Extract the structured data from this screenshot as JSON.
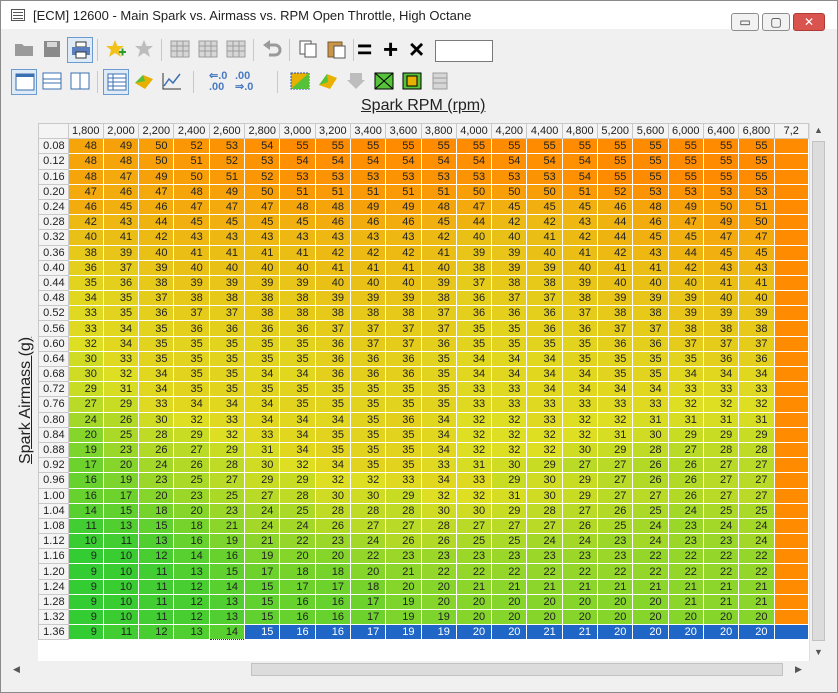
{
  "window": {
    "title": "[ECM] 12600 - Main Spark vs. Airmass vs. RPM Open Throttle, High Octane",
    "minimize": "▭",
    "maximize": "▢",
    "close": "✕"
  },
  "toolbar": {
    "operators": [
      "=",
      "+",
      "×"
    ],
    "value": "",
    "adjust_up": ".0 .00",
    "adjust_down": ".00 .0"
  },
  "table": {
    "x_axis_title": "Spark RPM (rpm)",
    "y_axis_title": "Spark Airmass (g)",
    "columns": [
      "1,800",
      "2,000",
      "2,200",
      "2,400",
      "2,600",
      "2,800",
      "3,000",
      "3,200",
      "3,400",
      "3,600",
      "3,800",
      "4,000",
      "4,200",
      "4,400",
      "4,800",
      "5,200",
      "5,600",
      "6,000",
      "6,400",
      "6,800",
      "7,2"
    ],
    "rows": [
      "0.08",
      "0.12",
      "0.16",
      "0.20",
      "0.24",
      "0.28",
      "0.32",
      "0.36",
      "0.40",
      "0.44",
      "0.48",
      "0.52",
      "0.56",
      "0.60",
      "0.64",
      "0.68",
      "0.72",
      "0.76",
      "0.80",
      "0.84",
      "0.88",
      "0.92",
      "0.96",
      "1.00",
      "1.04",
      "1.08",
      "1.12",
      "1.16",
      "1.20",
      "1.24",
      "1.28",
      "1.32",
      "1.36"
    ],
    "values": [
      [
        "48",
        "49",
        "50",
        "52",
        "53",
        "54",
        "55",
        "55",
        "55",
        "55",
        "55",
        "55",
        "55",
        "55",
        "55",
        "55",
        "55",
        "55",
        "55",
        "55",
        ""
      ],
      [
        "48",
        "48",
        "50",
        "51",
        "52",
        "53",
        "54",
        "54",
        "54",
        "54",
        "54",
        "54",
        "54",
        "54",
        "54",
        "55",
        "55",
        "55",
        "55",
        "55",
        ""
      ],
      [
        "48",
        "47",
        "49",
        "50",
        "51",
        "52",
        "53",
        "53",
        "53",
        "53",
        "53",
        "53",
        "53",
        "53",
        "54",
        "55",
        "55",
        "55",
        "55",
        "55",
        ""
      ],
      [
        "47",
        "46",
        "47",
        "48",
        "49",
        "50",
        "51",
        "51",
        "51",
        "51",
        "51",
        "50",
        "50",
        "50",
        "51",
        "52",
        "53",
        "53",
        "53",
        "53",
        ""
      ],
      [
        "46",
        "45",
        "46",
        "47",
        "47",
        "47",
        "48",
        "48",
        "49",
        "49",
        "48",
        "47",
        "45",
        "45",
        "45",
        "46",
        "48",
        "49",
        "50",
        "51",
        ""
      ],
      [
        "42",
        "43",
        "44",
        "45",
        "45",
        "45",
        "45",
        "46",
        "46",
        "46",
        "45",
        "44",
        "42",
        "42",
        "43",
        "44",
        "46",
        "47",
        "49",
        "50",
        ""
      ],
      [
        "40",
        "41",
        "42",
        "43",
        "43",
        "43",
        "43",
        "43",
        "43",
        "43",
        "42",
        "40",
        "40",
        "41",
        "42",
        "44",
        "45",
        "45",
        "47",
        "47",
        ""
      ],
      [
        "38",
        "39",
        "40",
        "41",
        "41",
        "41",
        "41",
        "42",
        "42",
        "42",
        "41",
        "39",
        "39",
        "40",
        "41",
        "42",
        "43",
        "44",
        "45",
        "45",
        ""
      ],
      [
        "36",
        "37",
        "39",
        "40",
        "40",
        "40",
        "40",
        "41",
        "41",
        "41",
        "40",
        "38",
        "39",
        "39",
        "40",
        "41",
        "41",
        "42",
        "43",
        "43",
        ""
      ],
      [
        "35",
        "36",
        "38",
        "39",
        "39",
        "39",
        "39",
        "40",
        "40",
        "40",
        "39",
        "37",
        "38",
        "38",
        "39",
        "40",
        "40",
        "40",
        "41",
        "41",
        ""
      ],
      [
        "34",
        "35",
        "37",
        "38",
        "38",
        "38",
        "38",
        "39",
        "39",
        "39",
        "38",
        "36",
        "37",
        "37",
        "38",
        "39",
        "39",
        "39",
        "40",
        "40",
        ""
      ],
      [
        "33",
        "35",
        "36",
        "37",
        "37",
        "38",
        "38",
        "38",
        "38",
        "38",
        "37",
        "36",
        "36",
        "36",
        "37",
        "38",
        "38",
        "39",
        "39",
        "39",
        ""
      ],
      [
        "33",
        "34",
        "35",
        "36",
        "36",
        "36",
        "36",
        "37",
        "37",
        "37",
        "37",
        "35",
        "35",
        "36",
        "36",
        "37",
        "37",
        "38",
        "38",
        "38",
        ""
      ],
      [
        "32",
        "34",
        "35",
        "35",
        "35",
        "35",
        "35",
        "36",
        "37",
        "37",
        "36",
        "35",
        "35",
        "35",
        "35",
        "36",
        "36",
        "37",
        "37",
        "37",
        ""
      ],
      [
        "30",
        "33",
        "35",
        "35",
        "35",
        "35",
        "35",
        "36",
        "36",
        "36",
        "35",
        "34",
        "34",
        "34",
        "35",
        "35",
        "35",
        "35",
        "36",
        "36",
        ""
      ],
      [
        "30",
        "32",
        "34",
        "35",
        "35",
        "34",
        "34",
        "36",
        "36",
        "36",
        "35",
        "34",
        "34",
        "34",
        "34",
        "35",
        "35",
        "34",
        "34",
        "34",
        ""
      ],
      [
        "29",
        "31",
        "34",
        "35",
        "35",
        "35",
        "35",
        "35",
        "35",
        "35",
        "35",
        "33",
        "33",
        "34",
        "34",
        "34",
        "34",
        "33",
        "33",
        "33",
        ""
      ],
      [
        "27",
        "29",
        "33",
        "34",
        "34",
        "34",
        "35",
        "35",
        "35",
        "35",
        "35",
        "33",
        "33",
        "33",
        "33",
        "33",
        "33",
        "32",
        "32",
        "32",
        ""
      ],
      [
        "24",
        "26",
        "30",
        "32",
        "33",
        "34",
        "34",
        "34",
        "35",
        "36",
        "34",
        "32",
        "32",
        "33",
        "32",
        "32",
        "31",
        "31",
        "31",
        "31",
        ""
      ],
      [
        "20",
        "25",
        "28",
        "29",
        "32",
        "33",
        "34",
        "35",
        "35",
        "35",
        "34",
        "32",
        "32",
        "32",
        "32",
        "31",
        "30",
        "29",
        "29",
        "29",
        ""
      ],
      [
        "19",
        "23",
        "26",
        "27",
        "29",
        "31",
        "34",
        "35",
        "35",
        "35",
        "34",
        "32",
        "32",
        "32",
        "30",
        "29",
        "28",
        "27",
        "28",
        "28",
        ""
      ],
      [
        "17",
        "20",
        "24",
        "26",
        "28",
        "30",
        "32",
        "34",
        "35",
        "35",
        "33",
        "31",
        "30",
        "29",
        "27",
        "27",
        "26",
        "26",
        "27",
        "27",
        ""
      ],
      [
        "16",
        "19",
        "23",
        "25",
        "27",
        "29",
        "29",
        "32",
        "32",
        "33",
        "34",
        "33",
        "29",
        "30",
        "29",
        "27",
        "26",
        "26",
        "27",
        "27",
        ""
      ],
      [
        "16",
        "17",
        "20",
        "23",
        "25",
        "27",
        "28",
        "30",
        "30",
        "29",
        "32",
        "32",
        "31",
        "30",
        "29",
        "27",
        "27",
        "26",
        "27",
        "27",
        ""
      ],
      [
        "14",
        "15",
        "18",
        "20",
        "23",
        "24",
        "25",
        "28",
        "28",
        "28",
        "30",
        "30",
        "29",
        "28",
        "27",
        "26",
        "25",
        "24",
        "25",
        "25",
        ""
      ],
      [
        "11",
        "13",
        "15",
        "18",
        "21",
        "24",
        "24",
        "26",
        "27",
        "27",
        "28",
        "27",
        "27",
        "27",
        "26",
        "25",
        "24",
        "23",
        "24",
        "24",
        ""
      ],
      [
        "10",
        "11",
        "13",
        "16",
        "19",
        "21",
        "22",
        "23",
        "24",
        "26",
        "26",
        "25",
        "25",
        "24",
        "24",
        "23",
        "24",
        "23",
        "23",
        "24",
        ""
      ],
      [
        "9",
        "10",
        "12",
        "14",
        "16",
        "19",
        "20",
        "20",
        "22",
        "23",
        "23",
        "23",
        "23",
        "23",
        "23",
        "23",
        "22",
        "22",
        "22",
        "22",
        ""
      ],
      [
        "9",
        "10",
        "11",
        "13",
        "15",
        "17",
        "18",
        "18",
        "20",
        "21",
        "22",
        "22",
        "22",
        "22",
        "22",
        "22",
        "22",
        "22",
        "22",
        "22",
        ""
      ],
      [
        "9",
        "10",
        "11",
        "12",
        "14",
        "15",
        "17",
        "17",
        "18",
        "20",
        "20",
        "21",
        "21",
        "21",
        "21",
        "21",
        "21",
        "21",
        "21",
        "21",
        ""
      ],
      [
        "9",
        "10",
        "11",
        "12",
        "13",
        "15",
        "16",
        "16",
        "17",
        "19",
        "20",
        "20",
        "20",
        "20",
        "20",
        "20",
        "20",
        "21",
        "21",
        "21",
        ""
      ],
      [
        "9",
        "10",
        "11",
        "12",
        "13",
        "15",
        "16",
        "16",
        "17",
        "19",
        "19",
        "20",
        "20",
        "20",
        "20",
        "20",
        "20",
        "20",
        "20",
        "20",
        ""
      ],
      [
        "9",
        "11",
        "12",
        "13",
        "14",
        "15",
        "16",
        "16",
        "17",
        "19",
        "19",
        "20",
        "20",
        "21",
        "21",
        "20",
        "20",
        "20",
        "20",
        "20",
        ""
      ]
    ],
    "selected_row": "1.36",
    "selected_from_column": "2,800",
    "cursor_column": "2,600",
    "palette": {
      "low": "#33cc33",
      "mid": "#dede22",
      "high": "#ff8c00",
      "selection": "#1f66c6"
    }
  }
}
